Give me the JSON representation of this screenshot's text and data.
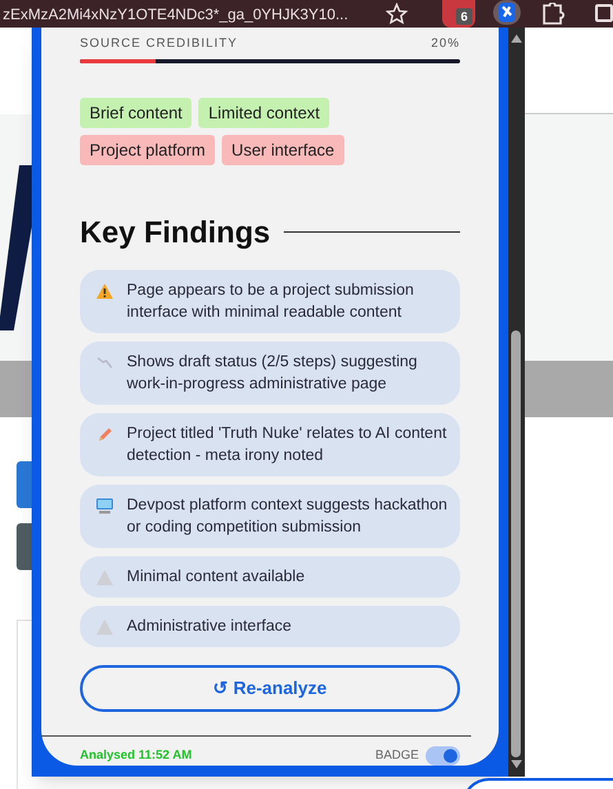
{
  "browser": {
    "url": "zExMzA2Mi4xNzY1OTE4NDc3*_ga_0YHJK3Y10...",
    "extension_badge": "6"
  },
  "credibility": {
    "label": "SOURCE CREDIBILITY",
    "value": "20%",
    "level": 0.2
  },
  "tags": [
    {
      "label": "Brief content",
      "color": "#c4f0b0"
    },
    {
      "label": "Limited context",
      "color": "#c4f0b0"
    },
    {
      "label": "Project platform",
      "color": "#f9b9b9"
    },
    {
      "label": "User interface",
      "color": "#f9b9b9"
    }
  ],
  "key_findings": {
    "title": "Key Findings",
    "items": [
      {
        "kind": "warning",
        "text": "Page appears to be a project submission interface with minimal readable content"
      },
      {
        "kind": "trend",
        "text": "Shows draft status (2/5 steps) suggesting work-in-progress administrative page"
      },
      {
        "kind": "pencil",
        "text": "Project titled 'Truth Nuke' relates to AI content detection - meta irony noted"
      },
      {
        "kind": "monitor",
        "text": "Devpost platform context suggests hackathon or coding competition submission"
      },
      {
        "kind": "faded-warning",
        "text": "Minimal content available"
      },
      {
        "kind": "faded-warning",
        "text": "Administrative interface"
      }
    ]
  },
  "reanalyze": {
    "icon": "↺",
    "label": "Re-analyze"
  },
  "footer": {
    "status": "Analysed 11:52 AM",
    "badge_label": "BADGE",
    "badge_on": true
  }
}
